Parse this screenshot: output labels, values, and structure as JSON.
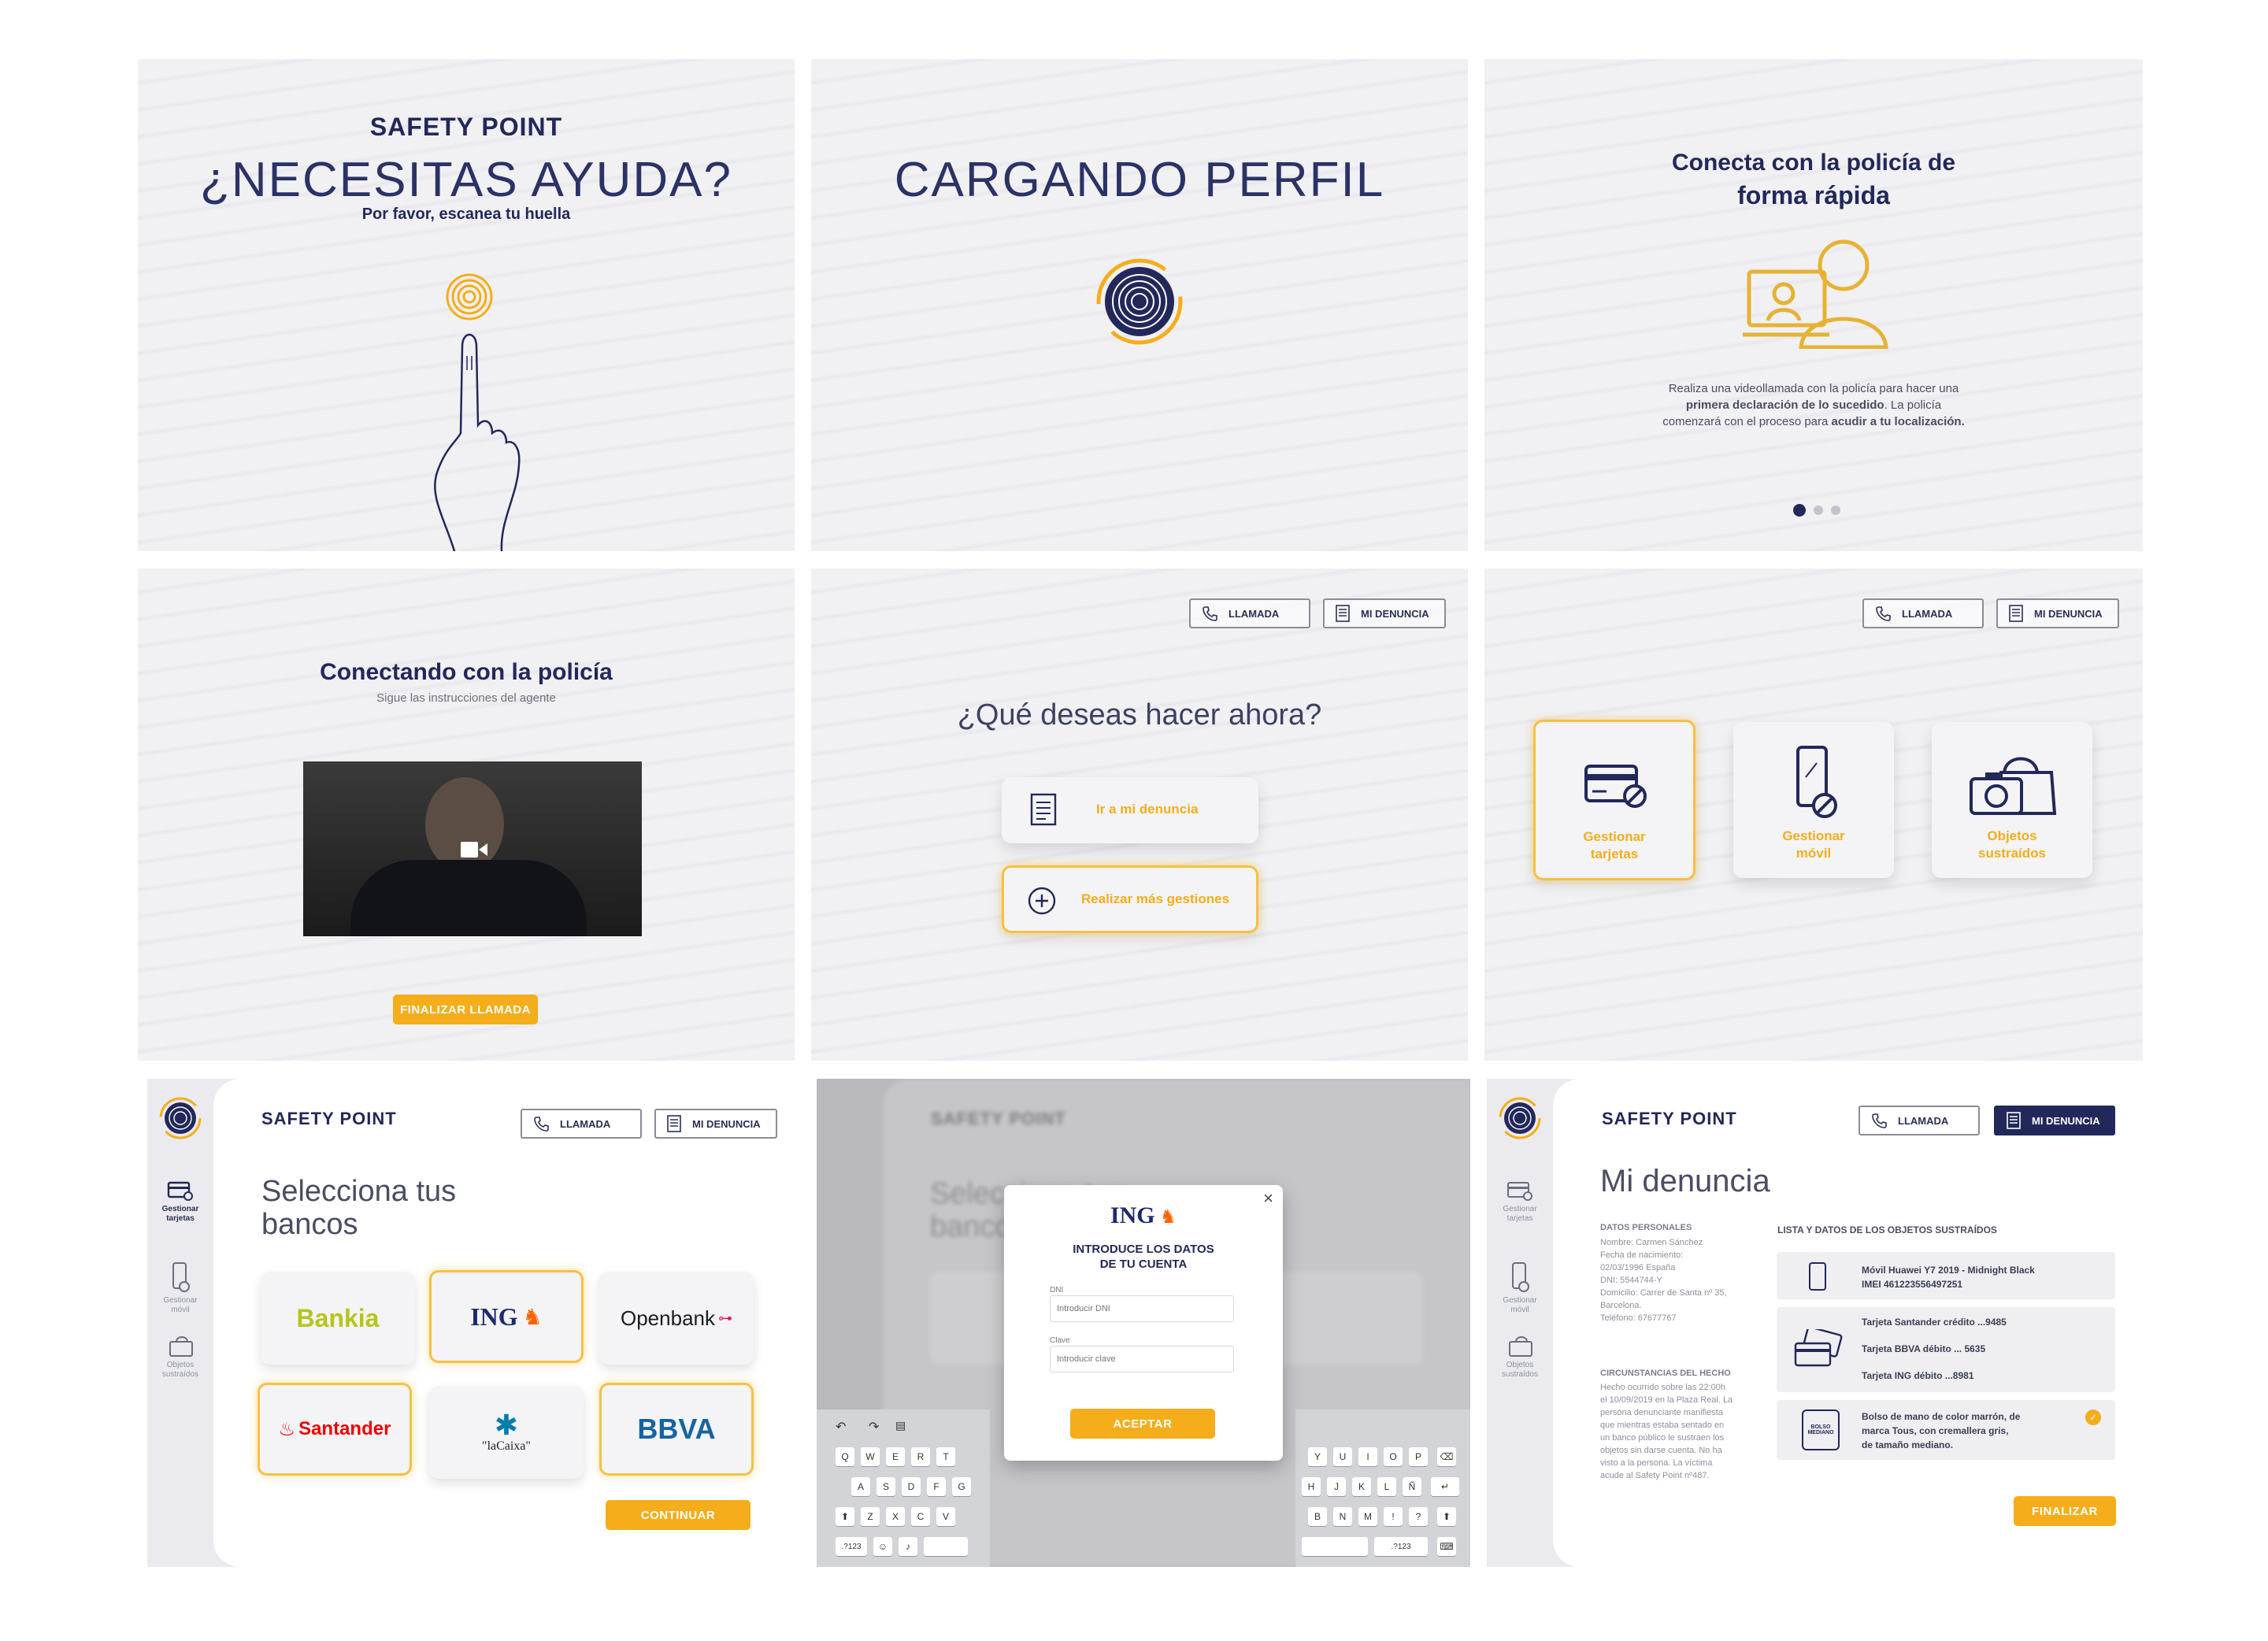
{
  "brand": {
    "logo": "SAFETY POINT"
  },
  "topbar": {
    "call_label": "LLAMADA",
    "report_label": "MI DENUNCIA"
  },
  "screen1": {
    "heading": "¿NECESITAS AYUDA?",
    "subheading": "Por favor, escanea tu huella"
  },
  "screen2": {
    "heading": "CARGANDO PERFIL"
  },
  "screen3": {
    "title_line1": "Conecta con la policía de",
    "title_line2": "forma rápida",
    "desc_line1": "Realiza una videollamada con la policía para hacer una",
    "desc_line2_bold": "primera declaración de lo sucedido",
    "desc_line2_rest": ". La policía",
    "desc_line3": "comenzará con el proceso para",
    "desc_line3_bold": "acudir a tu localización.",
    "pager_active": 1,
    "pager_total": 3
  },
  "screen4": {
    "title": "Conectando con la policía",
    "subtitle": "Sigue las instrucciones del agente",
    "end_call": "FINALIZAR LLAMADA"
  },
  "screen5": {
    "question": "¿Qué deseas hacer ahora?",
    "option1": "Ir a mi denuncia",
    "option2": "Realizar más gestiones"
  },
  "screen6": {
    "cards": [
      {
        "line1": "Gestionar",
        "line2": "tarjetas"
      },
      {
        "line1": "Gestionar",
        "line2": "móvil"
      },
      {
        "line1": "Objetos",
        "line2": "sustraídos"
      }
    ]
  },
  "sidebar": {
    "items": [
      {
        "line1": "Gestionar",
        "line2": "tarjetas"
      },
      {
        "line1": "Gestionar",
        "line2": "móvil"
      },
      {
        "line1": "Objetos",
        "line2": "sustraídos"
      }
    ]
  },
  "screen7": {
    "title_line1": "Selecciona tus",
    "title_line2": "bancos",
    "banks": [
      "Bankia",
      "ING",
      "Openbank",
      "Santander",
      "\"laCaixa\"",
      "BBVA"
    ],
    "continue": "CONTINUAR"
  },
  "screen8": {
    "bank_logo": "ING",
    "title_line1": "INTRODUCE LOS DATOS",
    "title_line2": "DE TU CUENTA",
    "dni_label": "DNI",
    "dni_placeholder": "Introducir DNI",
    "pass_label": "Clave",
    "pass_placeholder": "Introducir clave",
    "accept": "ACEPTAR",
    "close": "×",
    "keys_left": [
      [
        "Q",
        "W",
        "E",
        "R",
        "T"
      ],
      [
        "A",
        "S",
        "D",
        "F",
        "G"
      ],
      [
        "Z",
        "X",
        "C",
        "V"
      ]
    ],
    "keys_right": [
      [
        "Y",
        "U",
        "I",
        "O",
        "P"
      ],
      [
        "H",
        "J",
        "K",
        "L",
        "Ñ"
      ],
      [
        "B",
        "N",
        "M",
        "!",
        "?"
      ]
    ],
    "num_key": ".?123"
  },
  "screen9": {
    "title": "Mi denuncia",
    "personal_heading": "DATOS PERSONALES",
    "personal_lines": [
      "Nombre: Carmen Sánchez",
      "Fecha de nacimiento:",
      "02/03/1996 España",
      "DNI: 5544744-Y",
      "Domicilio: Carrer de Santa nº 35,",
      "Barcelona.",
      "Teléfono: 67677767"
    ],
    "circ_heading": "CIRCUNSTANCIAS DEL HECHO",
    "circ_lines": [
      "Hecho ocurrido sobre las 22:00h",
      "el 10/09/2019 en la Plaza Real. La",
      "persona denunciante manifiesta",
      "que mientras estaba sentado en",
      "un banco público le sustraen los",
      "objetos sin darse cuenta. No ha",
      "visto a la persona. La víctima",
      "acude al Safety Point nº487."
    ],
    "list_heading": "LISTA Y DATOS DE LOS OBJETOS SUSTRAÍDOS",
    "phone_line1": "Móvil Huawei Y7 2019 - Midnight Black",
    "phone_line2": "IMEI 461223556497251",
    "cards": [
      "Tarjeta Santander crédito ...9485",
      "Tarjeta BBVA débito ... 5635",
      "Tarjeta ING débito ...8981"
    ],
    "bag_icon_label": "BOLSO MEDIANO",
    "bag_lines": [
      "Bolso de mano de color marrón, de",
      "marca Tous, con cremallera gris,",
      "de tamaño mediano."
    ],
    "finish": "FINALIZAR"
  },
  "colors": {
    "navy": "#22285a",
    "accent": "#f5ad1b",
    "panel_bg": "#f1f1f4"
  }
}
